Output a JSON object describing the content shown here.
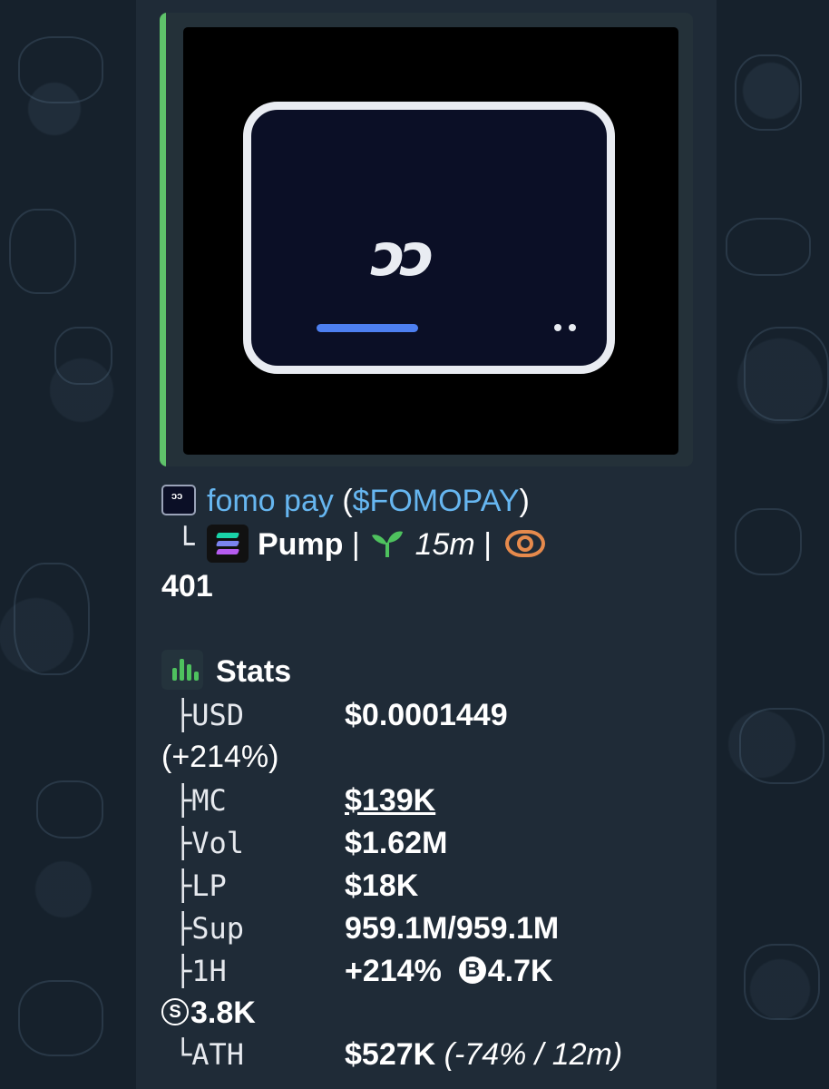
{
  "preview": {
    "logo_text": "ɔɔ"
  },
  "token": {
    "name": "fomo pay",
    "ticker_open": "(",
    "ticker": "$FOMOPAY",
    "ticker_close": ")",
    "icon": "fomo-pay-token-icon"
  },
  "meta": {
    "tree_end": "└",
    "chain_icon": "solana-icon",
    "platform": "Pump",
    "separator": "|",
    "age_icon": "sprout-icon",
    "age": "15m",
    "views_icon": "eye-icon",
    "views": "401"
  },
  "stats": {
    "icon": "bar-chart-icon",
    "heading": "Stats",
    "rows": [
      {
        "branch": "├",
        "label": "USD",
        "value": "$0.0001449",
        "continuation": "(+214%)"
      },
      {
        "branch": "├",
        "label": "MC",
        "value": "$139K"
      },
      {
        "branch": "├",
        "label": "Vol",
        "value": "$1.62M"
      },
      {
        "branch": "├",
        "label": "LP",
        "value": "$18K"
      },
      {
        "branch": "├",
        "label": "Sup",
        "value": "959.1M/959.1M"
      },
      {
        "branch": "├",
        "label": "1H",
        "value": "+214%",
        "buys_symbol": "B",
        "buys": "4.7K",
        "sells_symbol": "S",
        "sells": "3.8K"
      },
      {
        "branch": "└",
        "label": "ATH",
        "value": "$527K",
        "detail": "(-74% / 12m)"
      }
    ]
  },
  "colors": {
    "accent_bar": "#5fc26a",
    "link": "#66b6f0",
    "bubble": "#1f2b37",
    "background": "#16212c",
    "eye": "#e68a4c"
  }
}
